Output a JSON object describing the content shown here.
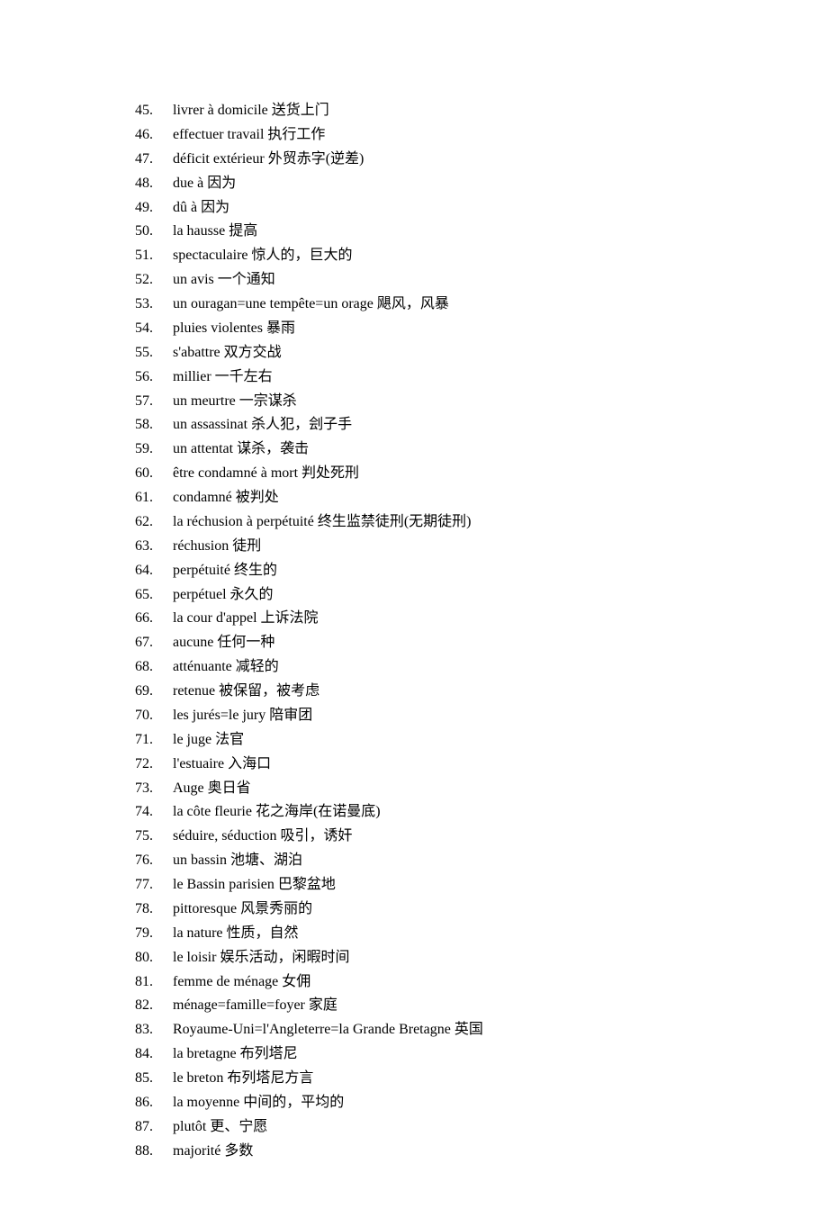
{
  "items": [
    {
      "term": "livrer à domicile",
      "def": "送货上门"
    },
    {
      "term": "effectuer travail",
      "def": "执行工作"
    },
    {
      "term": "déficit extérieur",
      "def": "外贸赤字(逆差)"
    },
    {
      "term": "due à",
      "def": "因为"
    },
    {
      "term": "dû à",
      "def": "因为"
    },
    {
      "term": "la hausse",
      "def": "提高"
    },
    {
      "term": "spectaculaire",
      "def": "惊人的，巨大的"
    },
    {
      "term": "un avis",
      "def": "一个通知"
    },
    {
      "term": "un ouragan=une tempête=un orage",
      "def": "飓风，风暴"
    },
    {
      "term": "pluies violentes",
      "def": "暴雨"
    },
    {
      "term": "s'abattre",
      "def": "双方交战"
    },
    {
      "term": "millier",
      "def": "一千左右"
    },
    {
      "term": "un meurtre",
      "def": "一宗谋杀"
    },
    {
      "term": "un assassinat",
      "def": "杀人犯，刽子手"
    },
    {
      "term": "un attentat",
      "def": "谋杀，袭击"
    },
    {
      "term": "être condamné à mort",
      "def": "判处死刑"
    },
    {
      "term": "condamné",
      "def": "被判处"
    },
    {
      "term": "la réchusion à perpétuité",
      "def": "终生监禁徒刑(无期徒刑)"
    },
    {
      "term": "réchusion",
      "def": "徒刑"
    },
    {
      "term": "perpétuité",
      "def": "终生的"
    },
    {
      "term": "perpétuel",
      "def": "永久的"
    },
    {
      "term": "la cour d'appel",
      "def": "上诉法院"
    },
    {
      "term": "aucune",
      "def": "任何一种"
    },
    {
      "term": "atténuante",
      "def": "减轻的"
    },
    {
      "term": "retenue",
      "def": "被保留，被考虑"
    },
    {
      "term": "les jurés=le jury",
      "def": "陪审团"
    },
    {
      "term": "le juge",
      "def": "法官"
    },
    {
      "term": "l'estuaire",
      "def": "入海口"
    },
    {
      "term": "Auge",
      "def": "奥日省"
    },
    {
      "term": "la côte fleurie",
      "def": "花之海岸(在诺曼底)"
    },
    {
      "term": "séduire, séduction",
      "def": "吸引，诱奸"
    },
    {
      "term": "un bassin",
      "def": "池塘、湖泊"
    },
    {
      "term": "le Bassin parisien",
      "def": "巴黎盆地"
    },
    {
      "term": "pittoresque",
      "def": "风景秀丽的"
    },
    {
      "term": "la nature",
      "def": "性质，自然"
    },
    {
      "term": "le loisir",
      "def": "娱乐活动，闲暇时间"
    },
    {
      "term": "femme de ménage",
      "def": "女佣"
    },
    {
      "term": "ménage=famille=foyer",
      "def": "家庭"
    },
    {
      "term": "Royaume-Uni=l'Angleterre=la Grande Bretagne",
      "def": "英国"
    },
    {
      "term": "la bretagne",
      "def": "布列塔尼"
    },
    {
      "term": "le breton",
      "def": "布列塔尼方言"
    },
    {
      "term": "la moyenne",
      "def": "中间的，平均的"
    },
    {
      "term": "plutôt",
      "def": "更、宁愿"
    },
    {
      "term": "majorité",
      "def": "多数"
    }
  ]
}
